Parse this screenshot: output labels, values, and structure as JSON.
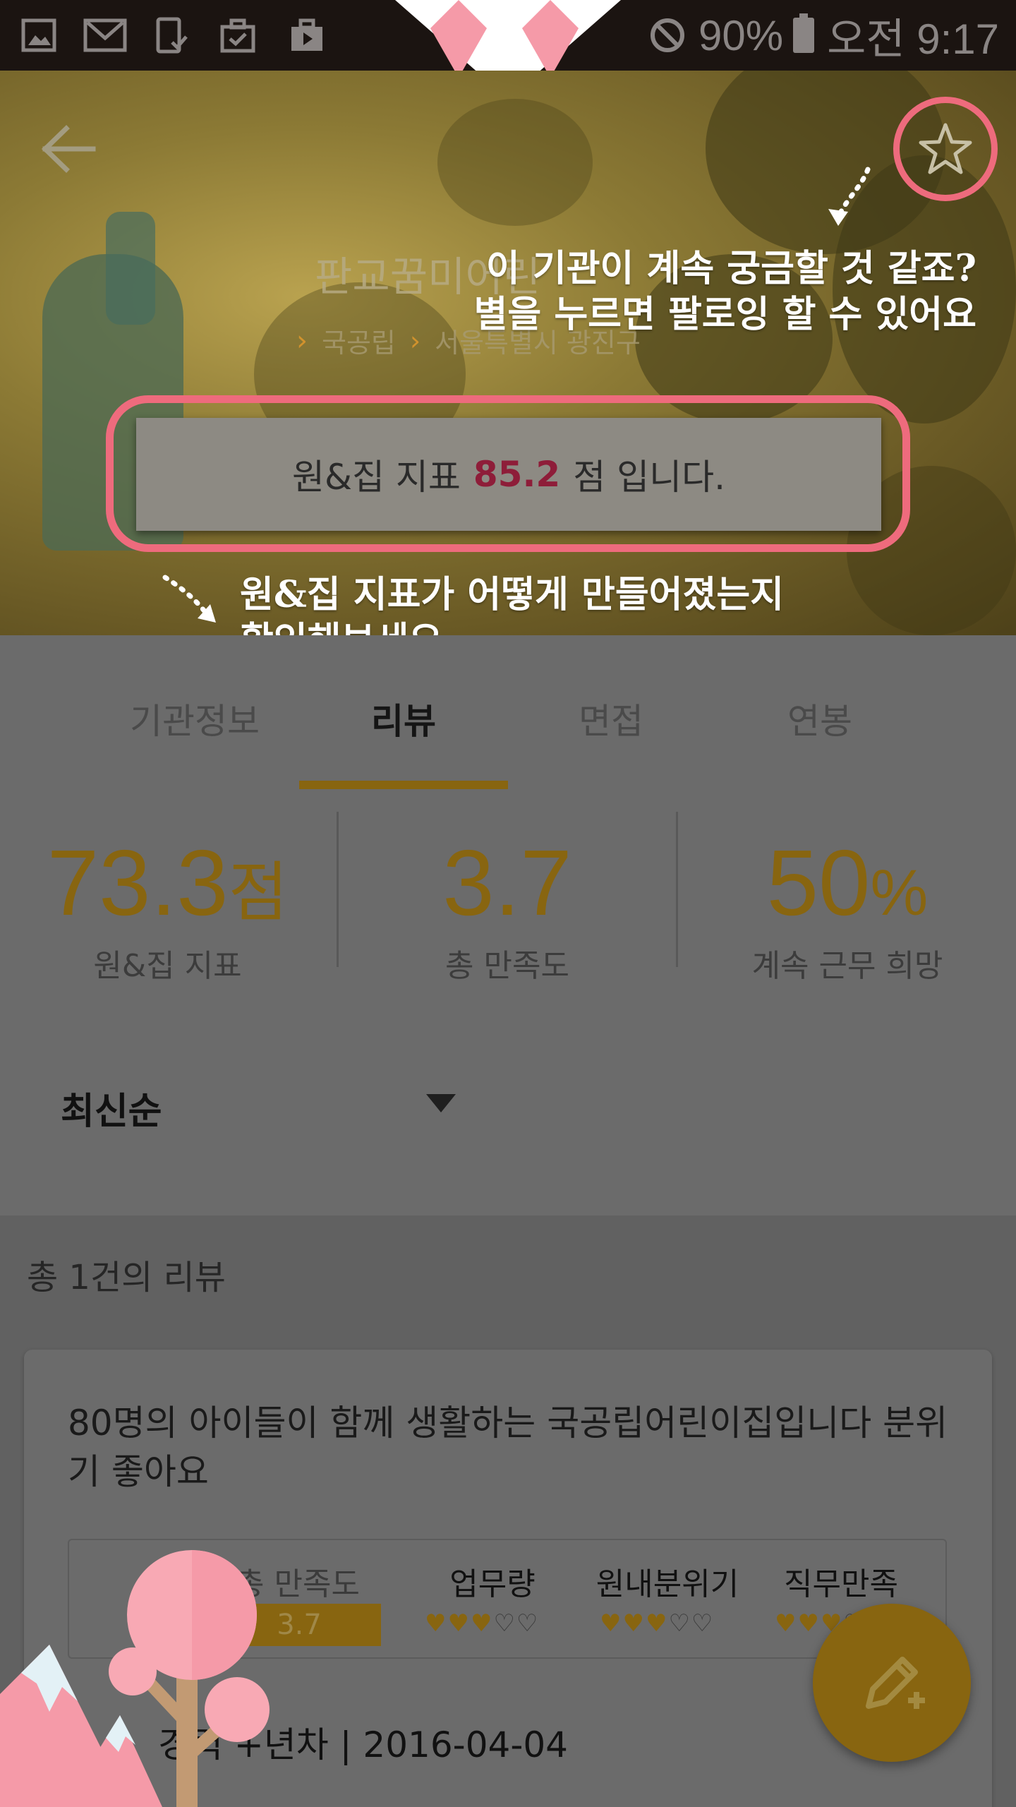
{
  "status_bar": {
    "battery": "90%",
    "time": "오전 9:17",
    "icons": [
      "image-icon",
      "mail-icon",
      "device-check-icon",
      "briefcase-check-icon",
      "video-bag-icon",
      "wifi-icon",
      "block-icon",
      "battery-icon"
    ]
  },
  "header": {
    "institution_name": "판교꿈미어린",
    "breadcrumb_type": "국공립",
    "breadcrumb_location": "서울특별시 광진구",
    "score_prefix": "원&집 지표",
    "score_value": "85.2",
    "score_suffix": "점 입니다."
  },
  "annotations": {
    "follow_tip_line1": "이 기관이 계속 궁금할 것 같죠?",
    "follow_tip_line2": "별을 누르면 팔로잉 할 수 있어요",
    "index_tip_line1": "원&집 지표가 어떻게 만들어졌는지",
    "index_tip_line2": "확인해보세요"
  },
  "tabs": [
    {
      "label": "기관정보",
      "active": false
    },
    {
      "label": "리뷰",
      "active": true
    },
    {
      "label": "면접",
      "active": false
    },
    {
      "label": "연봉",
      "active": false
    }
  ],
  "stats": [
    {
      "value": "73.3",
      "unit": "점",
      "label": "원&집 지표"
    },
    {
      "value": "3.7",
      "unit": "",
      "label": "총 만족도"
    },
    {
      "value": "50",
      "unit": "%",
      "label": "계속 근무 희망"
    }
  ],
  "sort": {
    "selected": "최신순"
  },
  "reviews": {
    "total_text": "총 1건의 리뷰",
    "items": [
      {
        "title": "80명의 아이들이 함께 생활하는 국공립어린이집입니다 분위기 좋아요",
        "total_label": "총 만족도",
        "total_value": "3.7",
        "total_score": 3.7,
        "ratings": [
          {
            "label": "업무량",
            "stars": 3,
            "max": 5
          },
          {
            "label": "원내분위기",
            "stars": 3,
            "max": 5
          },
          {
            "label": "직무만족",
            "stars": 3,
            "max": 5
          }
        ],
        "meta": "경력 +년차 | 2016-04-04"
      }
    ]
  },
  "fab": {
    "icon": "pencil-add-icon"
  },
  "colors": {
    "accent": "#886510",
    "highlight_ring": "#ee6b7d",
    "score_value": "#8e1d39",
    "overlay_bg": "#6b6b6b",
    "status_bar": "#1b1411"
  }
}
